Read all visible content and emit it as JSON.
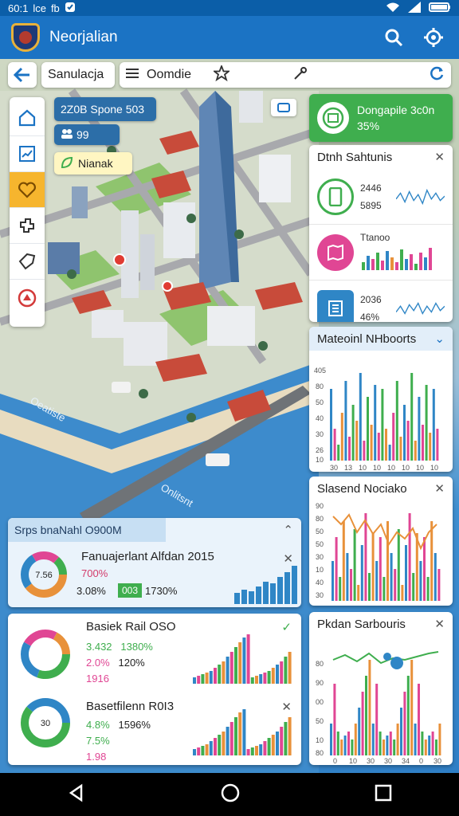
{
  "status": {
    "time": "60:1",
    "left_text": "lce",
    "icon_b": "fb",
    "icons": [
      "check-shield-icon",
      "wifi-icon",
      "signal-icon",
      "battery-icon"
    ]
  },
  "app": {
    "title": "Neorjalian",
    "actions": [
      "search-icon",
      "settings-gear-icon"
    ],
    "accent": "#1b73c4"
  },
  "toolbar": {
    "search_value": "Sanulacja",
    "mode_label": "Oomdie",
    "icons": [
      "back-arrow-icon",
      "list-icon",
      "star-icon",
      "pin-icon",
      "refresh-icon"
    ]
  },
  "rail": {
    "items": [
      "home-icon",
      "chart-icon",
      "heart-icon",
      "layers-icon",
      "tag-icon",
      "alert-icon"
    ]
  },
  "callouts": {
    "blue_title": "2Z0B Spone 503",
    "blue_sub": "99",
    "yellow": "Nianak"
  },
  "map": {
    "labels": [
      "Oeatiste",
      "Onlitsnt"
    ]
  },
  "green_card": {
    "title": "Dongapile 3c0n",
    "value": "35%"
  },
  "stats_panel": {
    "title": "Dtnh Sahtunis",
    "rows": [
      {
        "v1": "2446",
        "v2": "5895",
        "icon": "phone-icon",
        "color": "#3fae4e"
      },
      {
        "v1": "Ttanoo",
        "v2": "",
        "icon": "map-icon",
        "color": "#e04694"
      },
      {
        "v1": "2036",
        "v2": "46%",
        "icon": "building-icon",
        "color": "#2f86c6"
      }
    ]
  },
  "chart_panel_1": {
    "title": "Mateoinl NHboorts",
    "y_ticks": [
      "405",
      "80",
      "50",
      "40",
      "30",
      "26",
      "10"
    ],
    "x_ticks": [
      "30",
      "13",
      "10",
      "10",
      "10",
      "10",
      "10",
      "10",
      "10",
      "10",
      "10",
      "10",
      "20",
      "10"
    ]
  },
  "chart_panel_2": {
    "title": "Slasend Nociako",
    "y_ticks": [
      "90",
      "80",
      "50",
      "50",
      "30",
      "10",
      "40",
      "30"
    ]
  },
  "chart_panel_3": {
    "title": "Pkdan Sarbouris",
    "y_ticks": [
      "80",
      "90",
      "00",
      "50",
      "10",
      "80"
    ],
    "x_ticks": [
      "0",
      "10",
      "30",
      "30",
      "34",
      "0",
      "30"
    ]
  },
  "wide_panel": {
    "header": "Srps bnaNahl O900M",
    "title": "Fanuajerlant Alfdan 2015",
    "donut_label": "7.56",
    "pct_1": "700%",
    "pct_2": "3.08%",
    "badge": "003",
    "badge_value": "1730%"
  },
  "bottom_card": {
    "title_1": "Basiek Rail OSO",
    "stats_1": [
      {
        "a": "3.432",
        "b": "1380%"
      },
      {
        "a": "2.0%",
        "b": "120%"
      },
      {
        "a": "1916",
        "b": ""
      }
    ],
    "title_2": "Basetfilenn R0I3",
    "stats_2": [
      {
        "a": "4.8%",
        "b": "1596%"
      },
      {
        "a": "7.5%",
        "b": ""
      },
      {
        "a": "1.98",
        "b": ""
      }
    ],
    "donut2_label": "30"
  },
  "nav": [
    "back-triangle-icon",
    "home-circle-icon",
    "recents-square-icon"
  ]
}
